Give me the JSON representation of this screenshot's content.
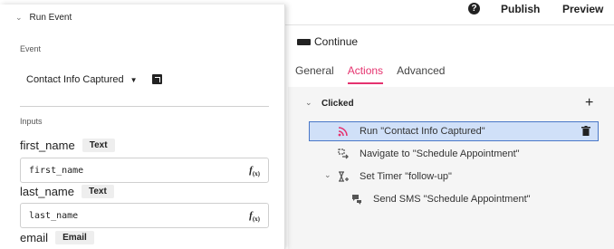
{
  "topbar": {
    "help_icon": "question-circle-icon",
    "publish_label": "Publish",
    "preview_label": "Preview"
  },
  "component": {
    "icon": "button-icon",
    "title": "Continue",
    "tabs": [
      {
        "label": "General",
        "active": false
      },
      {
        "label": "Actions",
        "active": true
      },
      {
        "label": "Advanced",
        "active": false
      }
    ],
    "accent_color": "#e5336f"
  },
  "actions": {
    "trigger_label": "Clicked",
    "items": [
      {
        "label": "Run \"Contact Info Captured\"",
        "icon": "rss-feed-icon",
        "selected": true
      },
      {
        "label": "Navigate to \"Schedule Appointment\"",
        "icon": "navigate-icon",
        "selected": false
      },
      {
        "label": "Set Timer \"follow-up\"",
        "icon": "timer-icon",
        "selected": false,
        "expanded": true
      },
      {
        "label": "Send SMS \"Schedule Appointment\"",
        "icon": "sms-icon",
        "selected": false
      }
    ],
    "selected_color": "#d0e0f8"
  },
  "panel": {
    "title": "Run Event",
    "event_section_label": "Event",
    "event_value": "Contact Info Captured",
    "inputs_section_label": "Inputs",
    "inputs": [
      {
        "name": "first_name",
        "type": "Text",
        "value": "first_name"
      },
      {
        "name": "last_name",
        "type": "Text",
        "value": "last_name"
      },
      {
        "name": "email",
        "type": "Email"
      }
    ],
    "fx_label": "f",
    "fx_sub": "(x)"
  }
}
